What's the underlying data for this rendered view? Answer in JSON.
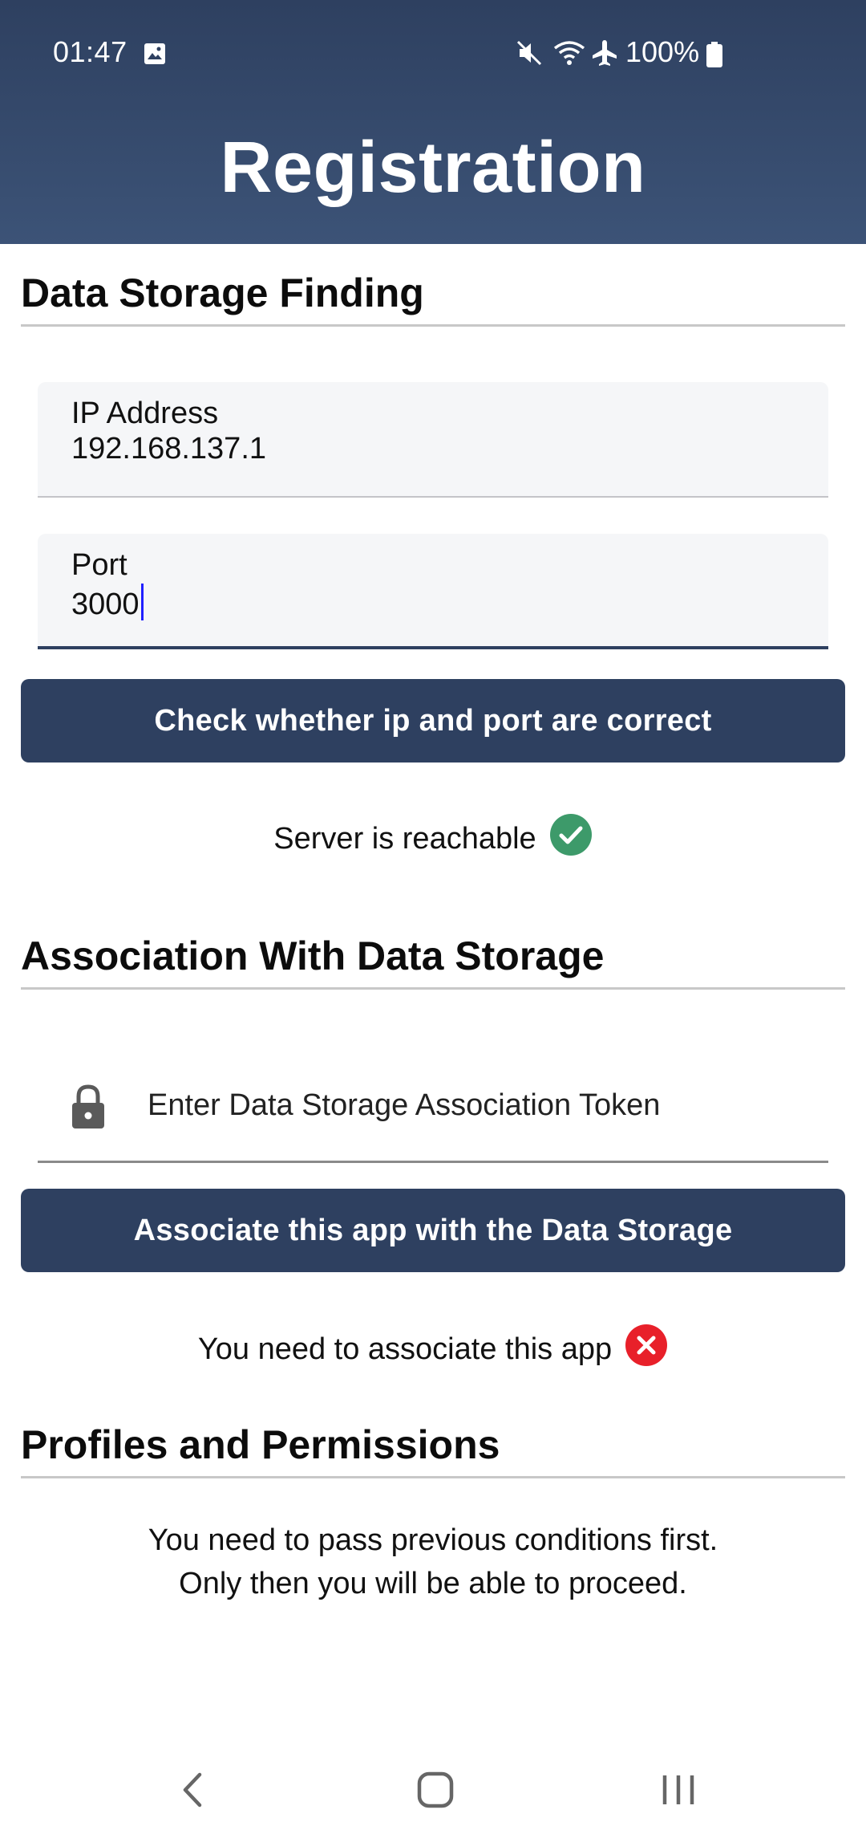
{
  "status_bar": {
    "time": "01:47",
    "battery_pct": "100%",
    "icons": [
      "gallery-icon",
      "mute-icon",
      "wifi-icon",
      "airplane-icon",
      "battery-icon"
    ]
  },
  "header": {
    "title": "Registration",
    "background": "#2e4060"
  },
  "sections": {
    "finding": {
      "title": "Data Storage Finding",
      "ip_label": "IP Address",
      "ip_value": "192.168.137.1",
      "port_label": "Port",
      "port_value": "3000",
      "check_button": "Check whether ip and port are correct",
      "status_text": "Server is reachable",
      "status_icon": "check-circle-icon",
      "status_color": "#3d9a6a"
    },
    "association": {
      "title": "Association With Data Storage",
      "token_placeholder": "Enter Data Storage Association Token",
      "associate_button": "Associate this app with the Data Storage",
      "status_text": "You need to associate this app",
      "status_icon": "error-circle-icon",
      "status_color": "#e8202a"
    },
    "profiles": {
      "title": "Profiles and Permissions",
      "info_line1": "You need to pass previous conditions first.",
      "info_line2": "Only then you will be able to proceed."
    }
  },
  "nav": {
    "icons": [
      "back-icon",
      "home-icon",
      "recents-icon"
    ]
  },
  "colors": {
    "primary": "#2e4060",
    "success": "#3d9a6a",
    "error": "#e8202a"
  }
}
